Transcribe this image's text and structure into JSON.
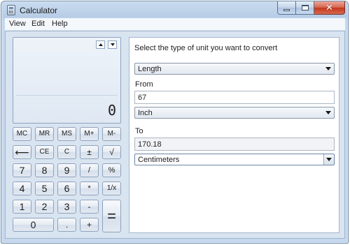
{
  "window": {
    "title": "Calculator"
  },
  "menu": [
    "View",
    "Edit",
    "Help"
  ],
  "display": {
    "value": "0"
  },
  "memory_buttons": [
    "MC",
    "MR",
    "MS",
    "M+",
    "M-"
  ],
  "keypad": {
    "backspace": "⟵",
    "ce": "CE",
    "c": "C",
    "plus_minus": "±",
    "sqrt": "√",
    "seven": "7",
    "eight": "8",
    "nine": "9",
    "divide": "/",
    "percent": "%",
    "four": "4",
    "five": "5",
    "six": "6",
    "multiply": "*",
    "reciprocal": "1/x",
    "one": "1",
    "two": "2",
    "three": "3",
    "minus": "-",
    "zero": "0",
    "decimal": ".",
    "plus": "+",
    "equals": "="
  },
  "converter": {
    "heading": "Select the type of unit you want to convert",
    "unit_type": "Length",
    "from_label": "From",
    "from_value": "67",
    "from_unit": "Inch",
    "to_label": "To",
    "to_value": "170.18",
    "to_unit": "Centimeters"
  }
}
